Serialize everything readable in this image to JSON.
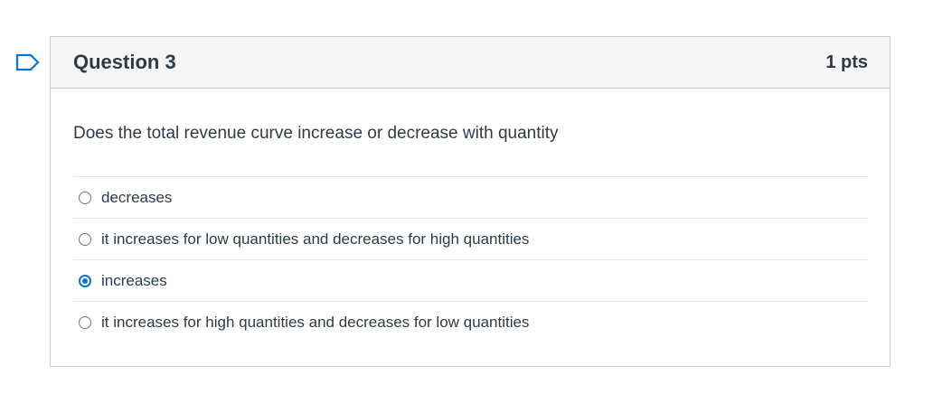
{
  "question": {
    "title": "Question 3",
    "points": "1 pts",
    "text": "Does the total revenue curve increase or decrease with quantity",
    "flag_icon": "flag-icon",
    "accent_color": "#0770e3",
    "answers": [
      {
        "label": "decreases",
        "selected": false
      },
      {
        "label": "it increases for low quantities and decreases for high quantities",
        "selected": false
      },
      {
        "label": "increases",
        "selected": true
      },
      {
        "label": "it increases for high quantities and decreases for low quantities",
        "selected": false
      }
    ]
  }
}
